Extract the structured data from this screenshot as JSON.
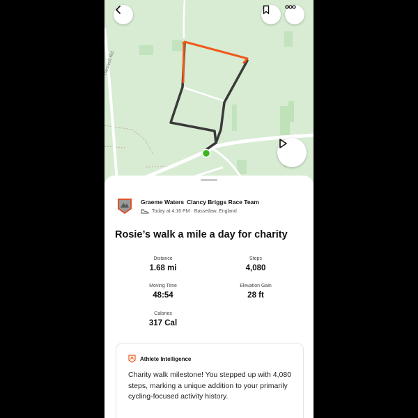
{
  "map": {
    "road_label": "Treswell Rd",
    "route_color": "#3a3a3a",
    "highlight_color": "#f05a1a",
    "start_color": "#3cb521"
  },
  "toolbar": {
    "back_icon": "chevron-left-icon",
    "bookmark_icon": "bookmark-icon",
    "more_icon": "more-horizontal-icon",
    "play_icon": "play-icon"
  },
  "athlete": {
    "name": "Graeme Waters",
    "club": "Clancy Briggs Race Team",
    "activity_icon": "shoe-icon",
    "meta": "Today at 4:16 PM · Bassetlaw, England"
  },
  "activity": {
    "title": "Rosie’s walk a mile a day for charity"
  },
  "stats": [
    {
      "label": "Distance",
      "value": "1.68 mi"
    },
    {
      "label": "Steps",
      "value": "4,080"
    },
    {
      "label": "Moving Time",
      "value": "48:54"
    },
    {
      "label": "Elevation Gain",
      "value": "28 ft"
    },
    {
      "label": "Calories",
      "value": "317 Cal"
    }
  ],
  "ai": {
    "title": "Athlete Intelligence",
    "text": "Charity walk milestone! You stepped up with 4,080 steps, marking a unique addition to your primarily cycling-focused activity history.",
    "accent": "#f05a1a"
  }
}
